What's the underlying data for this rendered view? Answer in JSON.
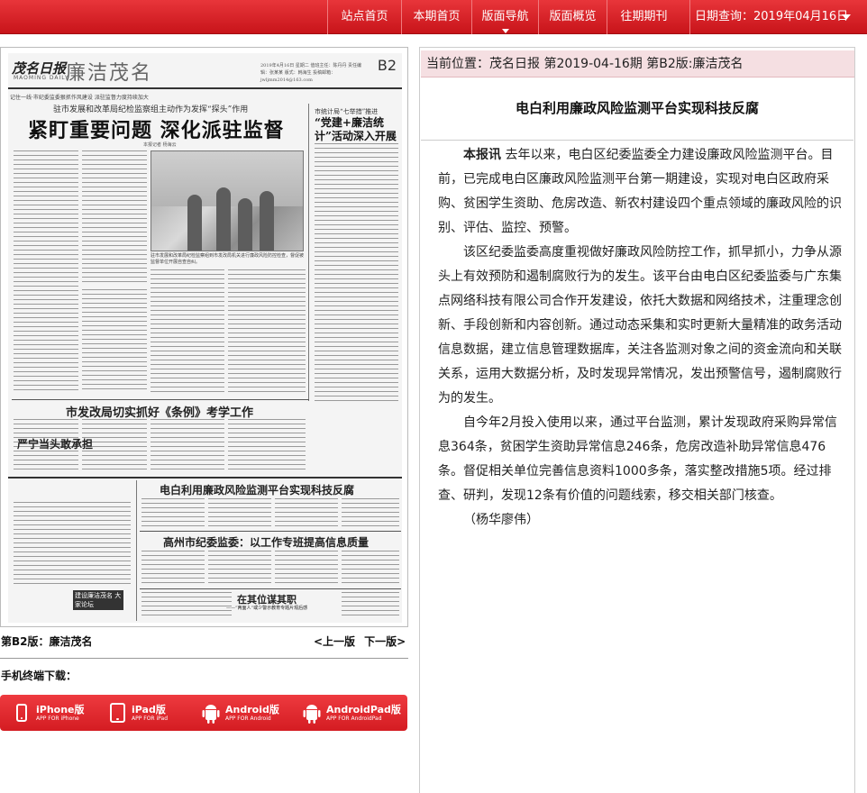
{
  "nav": {
    "items": [
      "站点首页",
      "本期首页",
      "版面导航",
      "版面概览",
      "往期期刊"
    ],
    "date_label": "日期查询：",
    "date_value": "2019年04月16日"
  },
  "newspaper": {
    "logo": "茂名日报",
    "logo_en": "MAOMING DAILY",
    "section_title": "廉洁茂名",
    "meta": "2019年4月16日 星期二 值班主任：陈丹丹 责任编辑：张某某 版式：韩海生 投稿邮箱：jwljmm2014@163.com",
    "page_no": "B2",
    "kicker": "记住一线·市纪委监委狠抓作风建设 派驻监督力度持续加大",
    "subhead": "驻市发展和改革局纪检监察组主动作为发挥“探头”作用",
    "headline": "紧盯重要问题 深化派驻监督",
    "byline": "本报记者 杨海云",
    "side_sub": "市统计局“七举措”推进",
    "side_head": "“党建+廉洁统计”活动深入开展",
    "photo_caption": "驻市发展和改革局纪检监察组到市发改局机关进行廉政风险防控检查，督促被监督单位开展自查自纠。",
    "headline2": "市发改局切实抓好《条例》考学工作",
    "box_head": "严宁当头敢承担",
    "headline3": "电白利用廉政风险监测平台实现科技反腐",
    "headline4": "高州市纪委监委：以工作专班提高信息质量",
    "headline5": "在其位谋其职",
    "headline5_sub": "——“两面人”或少警示教育专题片观后感",
    "column_logo": "建设廉洁茂名 大家论坛"
  },
  "page_label": "第B2版：廉洁茂名",
  "pager": {
    "prev": "<上一版",
    "next": "下一版>"
  },
  "download": {
    "title": "手机终端下载：",
    "apps": [
      {
        "name": "iPhone版",
        "sub": "APP FOR iPhone",
        "icon": "iphone-icon"
      },
      {
        "name": "iPad版",
        "sub": "APP FOR iPad",
        "icon": "ipad-icon"
      },
      {
        "name": "Android版",
        "sub": "APP FOR Android",
        "icon": "android-icon"
      },
      {
        "name": "AndroidPad版",
        "sub": "APP FOR AndroidPad",
        "icon": "android-pad-icon"
      }
    ]
  },
  "breadcrumb": "当前位置：茂名日报 第2019-04-16期 第B2版:廉洁茂名",
  "article": {
    "title": "电白利用廉政风险监测平台实现科技反腐",
    "lead_tag": "本报讯",
    "p1": "去年以来，电白区纪委监委全力建设廉政风险监测平台。目前，已完成电白区廉政风险监测平台第一期建设，实现对电白区政府采购、贫困学生资助、危房改造、新农村建设四个重点领域的廉政风险的识别、评估、监控、预警。",
    "p2": "该区纪委监委高度重视做好廉政风险防控工作，抓早抓小，力争从源头上有效预防和遏制腐败行为的发生。该平台由电白区纪委监委与广东集点网络科技有限公司合作开发建设，依托大数据和网络技术，注重理念创新、手段创新和内容创新。通过动态采集和实时更新大量精准的政务活动信息数据，建立信息管理数据库，关注各监测对象之间的资金流向和关联关系，运用大数据分析，及时发现异常情况，发出预警信号，遏制腐败行为的发生。",
    "p3": "自今年2月投入使用以来，通过平台监测，累计发现政府采购异常信息364条，贫困学生资助异常信息246条，危房改造补助异常信息476条。督促相关单位完善信息资料1000多条，落实整改措施5项。经过排查、研判，发现12条有价值的问题线索，移交相关部门核查。",
    "author": "（杨华廖伟）"
  },
  "colors": {
    "nav_red": "#d41c22",
    "breadcrumb_bg": "#f5dfe2"
  }
}
